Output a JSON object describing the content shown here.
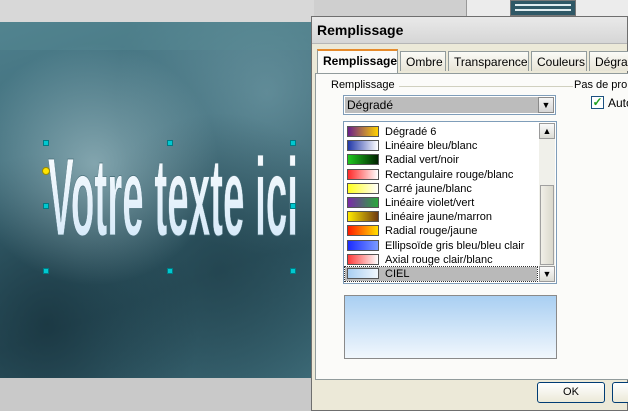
{
  "document": {
    "wordart_text": "Votre texte ici"
  },
  "dialog": {
    "title": "Remplissage",
    "tabs": [
      {
        "label": "Remplissage",
        "active": true
      },
      {
        "label": "Ombre",
        "active": false
      },
      {
        "label": "Transparence",
        "active": false
      },
      {
        "label": "Couleurs",
        "active": false
      },
      {
        "label": "Dégradé",
        "active": false
      }
    ],
    "fill_group_label": "Remplissage",
    "fill_type_value": "Dégradé",
    "step_group_label": "Pas de pro",
    "auto_checkbox_label": "Auto",
    "auto_checked": true,
    "gradients": [
      {
        "label": "Dégradé 6",
        "swatch": [
          "#6a1e8a",
          "#ffd200"
        ]
      },
      {
        "label": "Linéaire bleu/blanc",
        "swatch": [
          "#2238a8",
          "#ffffff"
        ]
      },
      {
        "label": "Radial vert/noir",
        "swatch": [
          "#1ec81e",
          "#002200"
        ]
      },
      {
        "label": "Rectangulaire rouge/blanc",
        "swatch": [
          "#ff2a2a",
          "#ffffff"
        ]
      },
      {
        "label": "Carré jaune/blanc",
        "swatch": [
          "#ffff1e",
          "#ffffff"
        ]
      },
      {
        "label": "Linéaire violet/vert",
        "swatch": [
          "#7a2aa8",
          "#2aa83a"
        ]
      },
      {
        "label": "Linéaire jaune/marron",
        "swatch": [
          "#ffea00",
          "#6e3a10"
        ]
      },
      {
        "label": "Radial rouge/jaune",
        "swatch": [
          "#ff1a00",
          "#ffe000"
        ]
      },
      {
        "label": "Ellipsoïde gris bleu/bleu clair",
        "swatch": [
          "#1c2cff",
          "#7a9aff"
        ]
      },
      {
        "label": "Axial rouge clair/blanc",
        "swatch": [
          "#ff3a3a",
          "#ffffff"
        ]
      },
      {
        "label": "CIEL",
        "swatch": [
          "#a9cff2",
          "#f1f7fd"
        ],
        "selected": true
      }
    ],
    "ok_label": "OK"
  },
  "colors": {
    "accent_tab": "#e68b2c",
    "preview_top": "#a9cff2",
    "preview_bottom": "#f1f7fd"
  }
}
